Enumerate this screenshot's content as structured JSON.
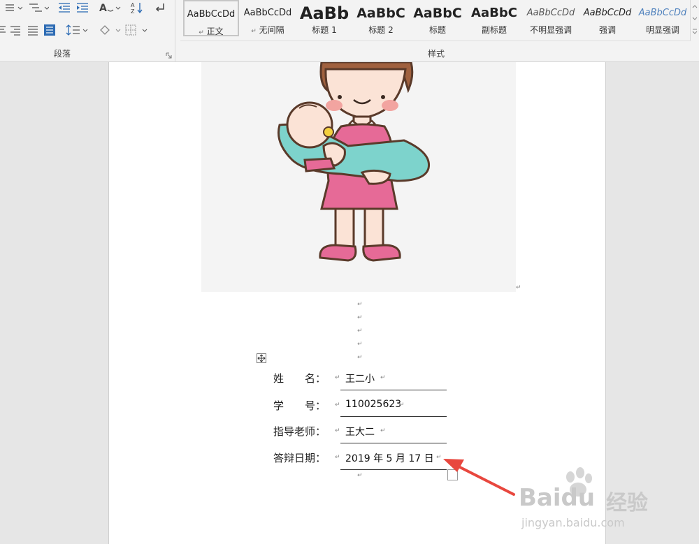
{
  "ribbon": {
    "paragraph_group_label": "段落",
    "styles_group_label": "样式",
    "styles": [
      {
        "preview": "AaBbCcDd",
        "name": "正文",
        "mark": "↵"
      },
      {
        "preview": "AaBbCcDd",
        "name": "无间隔",
        "mark": "↵"
      },
      {
        "preview": "AaBb",
        "name": "标题 1"
      },
      {
        "preview": "AaBbC",
        "name": "标题 2"
      },
      {
        "preview": "AaBbC",
        "name": "标题"
      },
      {
        "preview": "AaBbC",
        "name": "副标题"
      },
      {
        "preview": "AaBbCcDd",
        "name": "不明显强调"
      },
      {
        "preview": "AaBbCcDd",
        "name": "强调"
      },
      {
        "preview": "AaBbCcDd",
        "name": "明显强调"
      }
    ],
    "emphasis_color": "#4f81bd"
  },
  "document": {
    "paragraph_mark": "↵",
    "form": [
      {
        "label": "姓　　名：",
        "value": "王二小"
      },
      {
        "label": "学　　号：",
        "value": "110025623"
      },
      {
        "label": "指导老师：",
        "value": "王大二"
      },
      {
        "label": "答辩日期：",
        "value": "2019 年 5 月 17 日"
      }
    ]
  },
  "watermark": {
    "brand": "Baidu",
    "brand_cn": "经验",
    "url": "jingyan.baidu.com"
  },
  "annotation": {
    "arrow_color": "#e8473e"
  }
}
